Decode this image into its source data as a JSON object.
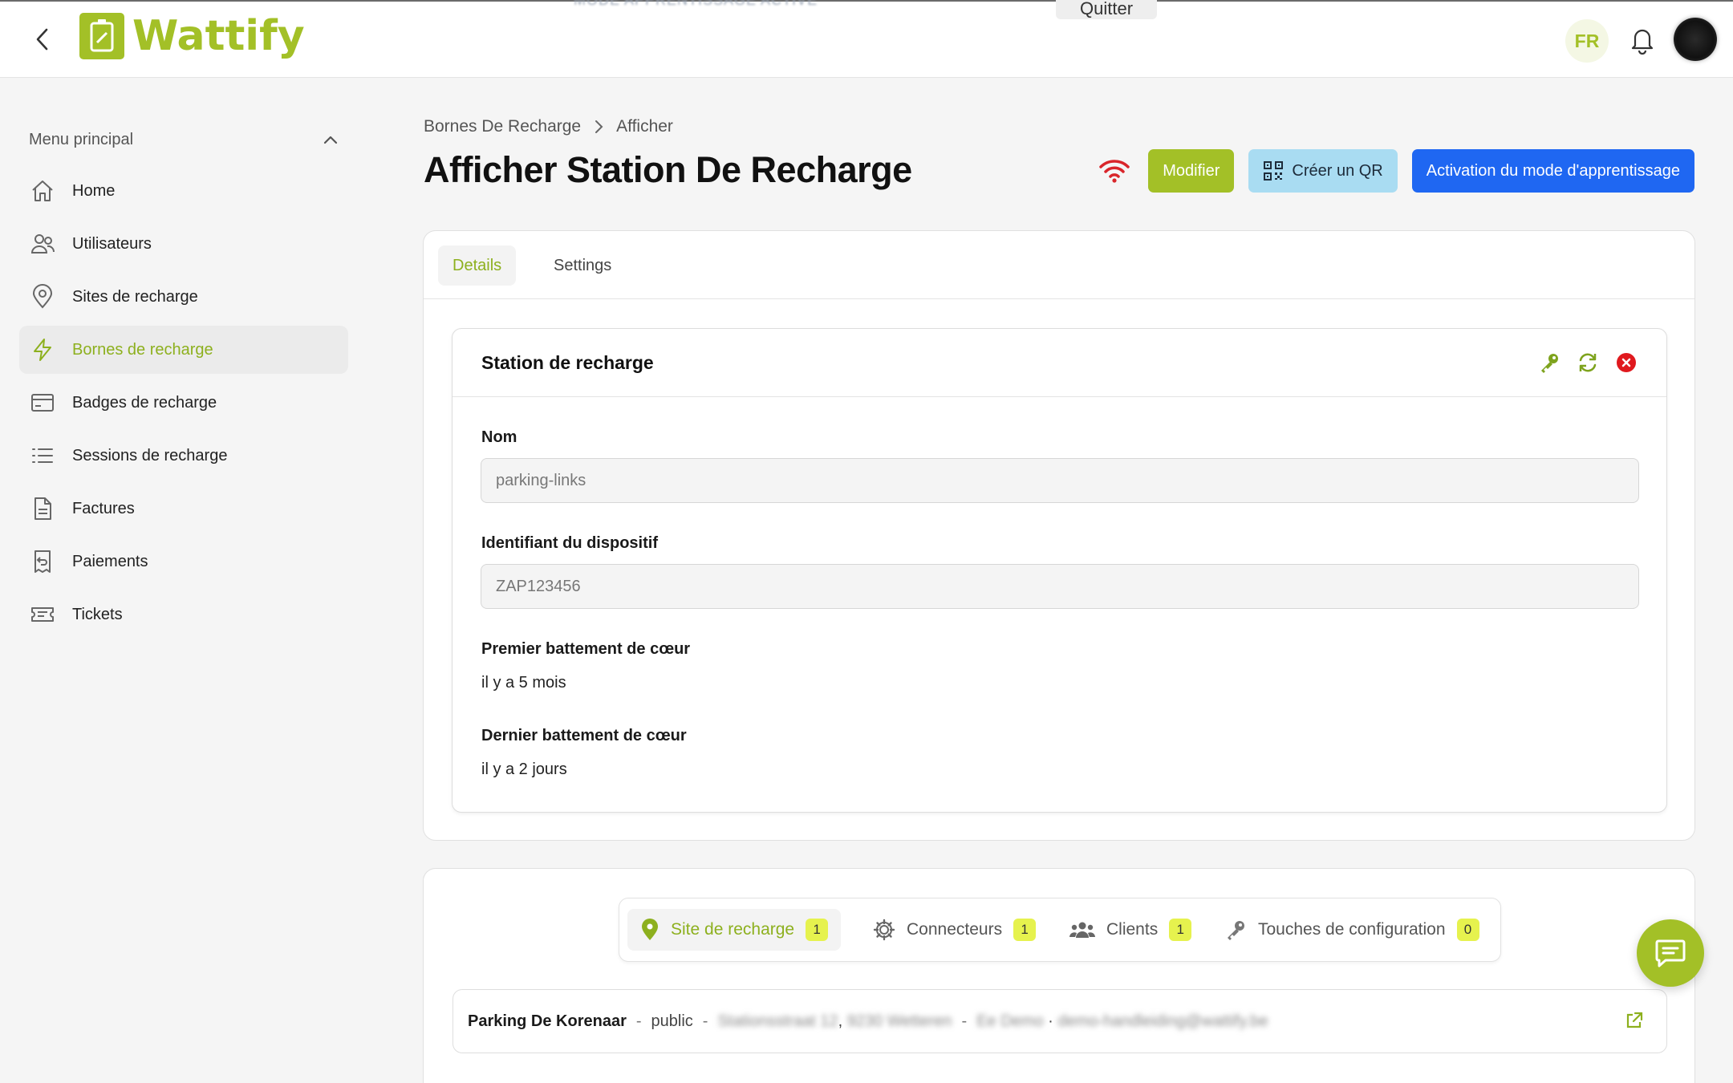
{
  "app": {
    "logo_text": "Wattify",
    "banner_text": "MODE APPRENTISSAGE ACTIVE",
    "quit_label": "Quitter",
    "lang": "FR",
    "brand_color": "#a3c027"
  },
  "sidebar": {
    "heading": "Menu principal",
    "items": [
      {
        "label": "Home",
        "icon": "home-icon"
      },
      {
        "label": "Utilisateurs",
        "icon": "users-icon"
      },
      {
        "label": "Sites de recharge",
        "icon": "map-pin-icon"
      },
      {
        "label": "Bornes de recharge",
        "icon": "lightning-icon",
        "active": true
      },
      {
        "label": "Badges de recharge",
        "icon": "card-icon"
      },
      {
        "label": "Sessions de recharge",
        "icon": "list-icon"
      },
      {
        "label": "Factures",
        "icon": "document-icon"
      },
      {
        "label": "Paiements",
        "icon": "receipt-icon"
      },
      {
        "label": "Tickets",
        "icon": "ticket-icon"
      }
    ]
  },
  "breadcrumb": {
    "parent": "Bornes De Recharge",
    "current": "Afficher"
  },
  "page": {
    "title": "Afficher Station De Recharge"
  },
  "actions": {
    "modify_label": "Modifier",
    "qr_label": "Créer un QR",
    "learning_label": "Activation du mode d'apprentissage"
  },
  "tabs": {
    "details": "Details",
    "settings": "Settings"
  },
  "station": {
    "title": "Station de recharge",
    "name_label": "Nom",
    "name_value": "parking-links",
    "device_id_label": "Identifiant du dispositif",
    "device_id_value": "ZAP123456",
    "first_heartbeat_label": "Premier battement de cœur",
    "first_heartbeat_value": "il y a 5 mois",
    "last_heartbeat_label": "Dernier battement de cœur",
    "last_heartbeat_value": "il y a 2 jours"
  },
  "related": {
    "tabs": [
      {
        "label": "Site de recharge",
        "count": "1",
        "icon": "map-pin-filled-icon",
        "active": true
      },
      {
        "label": "Connecteurs",
        "count": "1",
        "icon": "cog-icon"
      },
      {
        "label": "Clients",
        "count": "1",
        "icon": "group-icon"
      },
      {
        "label": "Touches de configuration",
        "count": "0",
        "icon": "key-icon"
      }
    ],
    "site": {
      "name": "Parking De Korenaar",
      "visibility": "public",
      "address_blurred": "Stationsstraat 12",
      "city_blurred": "9230 Wetteren",
      "contact_blurred": "Ee Demo",
      "email_blurred": "demo-handleiding@wattify.be"
    }
  }
}
